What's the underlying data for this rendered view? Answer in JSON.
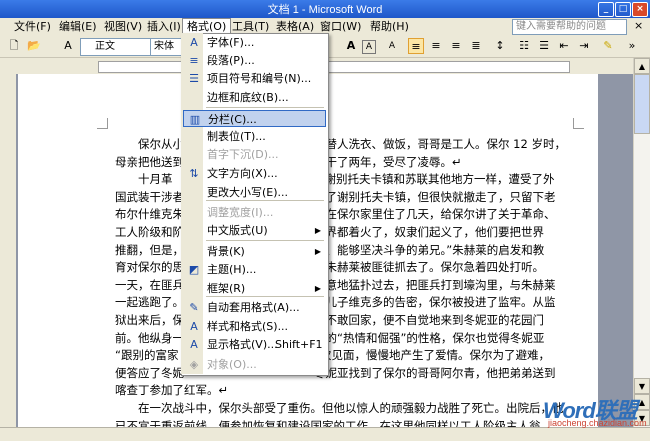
{
  "window": {
    "title": "文档 1 - Microsoft Word",
    "min": "_",
    "max": "□",
    "close": "×"
  },
  "menubar": {
    "items": [
      "文件(F)",
      "编辑(E)",
      "视图(V)",
      "插入(I)",
      "格式(O)",
      "工具(T)",
      "表格(A)",
      "窗口(W)",
      "帮助(H)"
    ],
    "help_placeholder": "键入需要帮助的问题"
  },
  "toolbar": {
    "style_value": "正文",
    "font_value": "宋体",
    "bold_label": "A",
    "align_active": "justify"
  },
  "format_menu": {
    "items": [
      {
        "label": "字体(F)...",
        "icon": "font-A-icon",
        "glyph": "A",
        "enabled": true
      },
      {
        "label": "段落(P)...",
        "icon": "paragraph-icon",
        "glyph": "≡",
        "enabled": true
      },
      {
        "label": "项目符号和编号(N)...",
        "icon": "bullets-icon",
        "glyph": "☰",
        "enabled": true
      },
      {
        "label": "边框和底纹(B)...",
        "icon": "",
        "glyph": "",
        "enabled": true
      },
      {
        "label": "分栏(C)...",
        "icon": "columns-icon",
        "glyph": "▥",
        "enabled": true,
        "highlight": true
      },
      {
        "label": "制表位(T)...",
        "icon": "",
        "glyph": "",
        "enabled": true
      },
      {
        "label": "首字下沉(D)...",
        "icon": "",
        "glyph": "",
        "enabled": false
      },
      {
        "label": "文字方向(X)...",
        "icon": "text-direction-icon",
        "glyph": "⇅",
        "enabled": true
      },
      {
        "label": "更改大小写(E)...",
        "icon": "",
        "glyph": "",
        "enabled": true
      },
      {
        "label": "调整宽度(I)...",
        "icon": "",
        "glyph": "",
        "enabled": false
      },
      {
        "label": "中文版式(U)",
        "icon": "",
        "glyph": "",
        "enabled": true,
        "submenu": true
      },
      {
        "label": "背景(K)",
        "icon": "",
        "glyph": "",
        "enabled": true,
        "submenu": true
      },
      {
        "label": "主题(H)...",
        "icon": "theme-icon",
        "glyph": "◩",
        "enabled": true
      },
      {
        "label": "框架(R)",
        "icon": "",
        "glyph": "",
        "enabled": true,
        "submenu": true
      },
      {
        "label": "自动套用格式(A)...",
        "icon": "autoformat-icon",
        "glyph": "✎",
        "enabled": true
      },
      {
        "label": "样式和格式(S)...",
        "icon": "styles-icon",
        "glyph": "A",
        "enabled": true
      },
      {
        "label": "显示格式(V)...",
        "icon": "reveal-format-icon",
        "glyph": "A",
        "enabled": true,
        "shortcut": "Shift+F1"
      },
      {
        "label": "对象(O)...",
        "icon": "object-icon",
        "glyph": "◈",
        "enabled": false
      }
    ]
  },
  "document": {
    "lines": [
      {
        "text": "保尔从小",
        "tail": "亲替人洗衣、做饭，哥哥是工人。保尔 12 岁时，"
      },
      {
        "text": "母亲把他送到",
        "tail": "里干了两年，受尽了凌辱。↵"
      }
    ],
    "para2_right": [
      "谢别托夫卡镇和苏联其他地方一样，遭受了外",
      "放了谢别托夫卡镇，但很快就撤走了，只留下老",
      "菜在保尔家里住了几天，给保尔讲了关于革命、",
      "世界都着火了，奴隶们起义了，他们要把世界",
      "的、能够坚决斗争的弟兄。”朱赫莱的启发和教",
      "被朱赫莱被匪徒抓去了。保尔急着四处打听。",
      "不意地猛扑过去，把匪兵打到壕沟里，与朱赫莱",
      "的儿子维克多的告密，保尔被投进了监牢。从监",
      "，不敢回家，便不自觉地来到冬妮亚的花园门",
      "尔的“热情和倔强”的性格，保尔也觉得冬妮亚",
      "几次见面，慢慢地产生了爱情。保尔为了避难，",
      "冬妮亚找到了保尔的哥哥阿尔青，他把弟弟送到"
    ],
    "para2_left": [
      "十月革",
      "国武装干涉者",
      "布尔什维克朱",
      "工人阶级和阶",
      "推翻，但是，",
      "育对保尔的思",
      "一天，在匪兵",
      "一起逃跑了。",
      "狱出来后，保",
      "前。他纵身一",
      "“跟别的富家",
      "便答应了冬妮"
    ],
    "para2_last": "喀查丁参加了红军。↵",
    "para3": [
      "在一次战斗中，保尔头部受了重伤。但他以惊人的顽强毅力战胜了死亡。出院后，他",
      "已不宜于重返前线，便参加恢复和建设国家的工作。在这里他同样以工人阶级主人翁"
    ]
  },
  "watermark": {
    "logo": "Word联盟",
    "url": "jiaocheng.chazidian.com"
  }
}
